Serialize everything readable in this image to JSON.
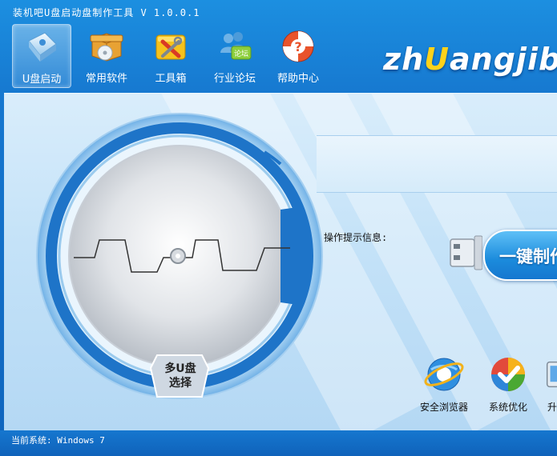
{
  "window": {
    "title": "装机吧U盘启动盘制作工具 V 1.0.0.1"
  },
  "toolbar": {
    "items": [
      {
        "label": "U盘启动",
        "icon": "usb-disk-icon",
        "active": true
      },
      {
        "label": "常用软件",
        "icon": "software-box-icon",
        "active": false
      },
      {
        "label": "工具箱",
        "icon": "toolbox-icon",
        "active": false
      },
      {
        "label": "行业论坛",
        "icon": "forum-icon",
        "active": false
      },
      {
        "label": "帮助中心",
        "icon": "lifebuoy-help-icon",
        "active": false
      }
    ]
  },
  "logo": {
    "pre": "zh",
    "u": "U",
    "post": "angjiba"
  },
  "disk": {
    "select_label_line1": "多U盘",
    "select_label_line2": "选择"
  },
  "info": {
    "label": "操作提示信息:"
  },
  "actions": {
    "onekey_label": "一键制作"
  },
  "apps": [
    {
      "label": "安全浏览器",
      "icon": "browser-icon"
    },
    {
      "label": "系统优化",
      "icon": "system-optimize-icon"
    },
    {
      "label": "升级",
      "icon": "upgrade-icon"
    }
  ],
  "status": {
    "current_system": "当前系统: Windows 7"
  },
  "colors": {
    "accent": "#1677cf",
    "panel": "#c4e2f8",
    "logo_u": "#ffd21a"
  }
}
